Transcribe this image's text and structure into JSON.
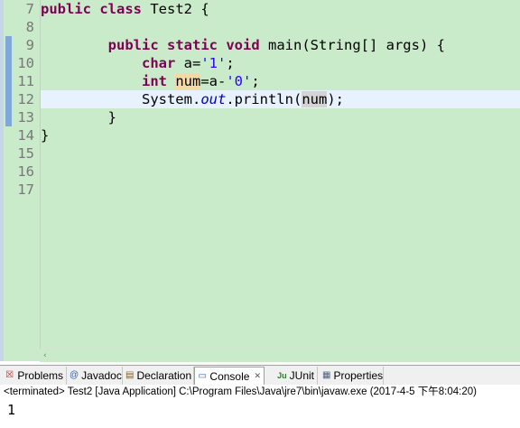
{
  "editor": {
    "line_numbers": [
      "7",
      "8",
      "9",
      "10",
      "11",
      "12",
      "13",
      "14",
      "15",
      "16",
      "17"
    ],
    "lines": {
      "l7": {
        "kw1": "public",
        "kw2": "class",
        "rest": " Test2 {"
      },
      "l9": {
        "indent": "        ",
        "kw1": "public",
        "kw2": "static",
        "kw3": "void",
        "rest": " main(String[] args) {"
      },
      "l10": {
        "indent": "            ",
        "kw": "char",
        "pre": " a=",
        "str": "'1'",
        "post": ";"
      },
      "l11": {
        "indent": "            ",
        "kw": "int",
        "sp": " ",
        "var": "num",
        "pre": "=a-",
        "str": "'0'",
        "post": ";"
      },
      "l12": {
        "indent": "            ",
        "pre": "System.",
        "field": "out",
        "mid": ".println(",
        "var": "num",
        "post": ");"
      },
      "l13": {
        "indent": "        ",
        "rest": "}"
      },
      "l14": {
        "rest": "}"
      }
    },
    "scroll_left_glyph": "‹"
  },
  "console_tabs": [
    {
      "label": "Problems",
      "icon": "problems-icon",
      "glyph": "☒"
    },
    {
      "label": "Javadoc",
      "icon": "javadoc-icon",
      "glyph": "@"
    },
    {
      "label": "Declaration",
      "icon": "declaration-icon",
      "glyph": "▤"
    },
    {
      "label": "Console",
      "icon": "console-icon",
      "glyph": "▭",
      "close": "✕"
    },
    {
      "label": "JUnit",
      "icon": "junit-icon",
      "glyph": "Ju"
    },
    {
      "label": "Properties",
      "icon": "properties-icon",
      "glyph": "▦"
    }
  ],
  "console": {
    "status": "<terminated> Test2 [Java Application] C:\\Program Files\\Java\\jre7\\bin\\javaw.exe (2017-4-5 下午8:04:20)",
    "output": "1"
  },
  "colors": {
    "editor_bg": "#c9ebc9",
    "keyword": "#7f0055",
    "string": "#2a00ff",
    "static_field": "#0000c0",
    "current_line": "#e8f2fe"
  }
}
